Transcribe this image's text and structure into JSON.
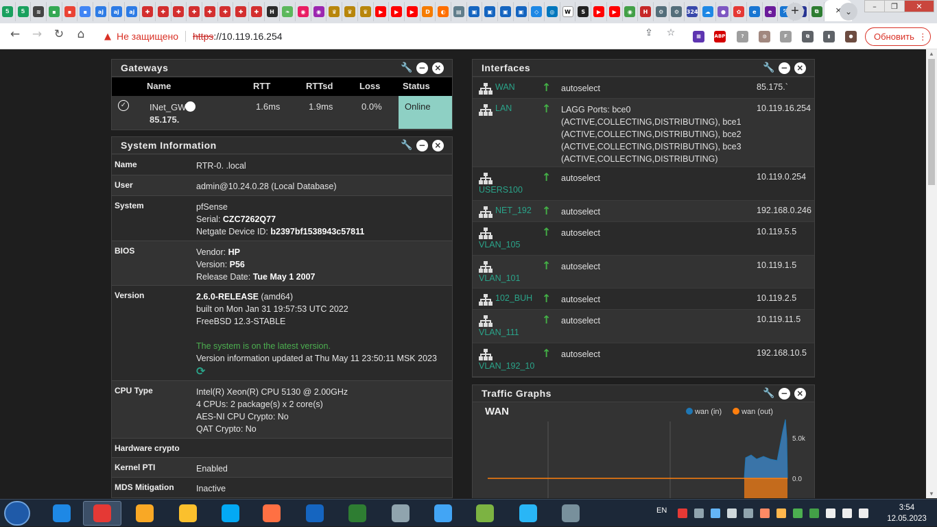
{
  "browser": {
    "tab_favicons": [
      {
        "name": "sheets",
        "color": "#1aa05e",
        "glyph": "Ꭶ"
      },
      {
        "name": "sheets",
        "color": "#1aa05e",
        "glyph": "Ꭶ"
      },
      {
        "name": "hub",
        "color": "#444444",
        "glyph": "≋"
      },
      {
        "name": "apps",
        "color": "#34a853",
        "glyph": "▪"
      },
      {
        "name": "apps",
        "color": "#ea4335",
        "glyph": "▪"
      },
      {
        "name": "apps",
        "color": "#4285f4",
        "glyph": "▪"
      },
      {
        "name": "aj",
        "color": "#2d7be5",
        "glyph": "aj"
      },
      {
        "name": "aj",
        "color": "#2d7be5",
        "glyph": "aj"
      },
      {
        "name": "aj",
        "color": "#2d7be5",
        "glyph": "aj"
      },
      {
        "name": "red-shield",
        "color": "#d32f2f",
        "glyph": "✚"
      },
      {
        "name": "red-shield",
        "color": "#d32f2f",
        "glyph": "✚"
      },
      {
        "name": "red-shield",
        "color": "#d32f2f",
        "glyph": "✚"
      },
      {
        "name": "red-shield",
        "color": "#d32f2f",
        "glyph": "✚"
      },
      {
        "name": "red-shield",
        "color": "#d32f2f",
        "glyph": "✚"
      },
      {
        "name": "red-shield",
        "color": "#d32f2f",
        "glyph": "✚"
      },
      {
        "name": "red-shield",
        "color": "#d32f2f",
        "glyph": "✚"
      },
      {
        "name": "red-shield",
        "color": "#d32f2f",
        "glyph": "✚"
      },
      {
        "name": "shield",
        "color": "#2b2b2b",
        "glyph": "H"
      },
      {
        "name": "leaf",
        "color": "#5cb85c",
        "glyph": "❧"
      },
      {
        "name": "color-wheel",
        "color": "#e91e63",
        "glyph": "◉"
      },
      {
        "name": "color-wheel",
        "color": "#9c27b0",
        "glyph": "◉"
      },
      {
        "name": "emblem",
        "color": "#b8860b",
        "glyph": "♛"
      },
      {
        "name": "emblem",
        "color": "#b8860b",
        "glyph": "♛"
      },
      {
        "name": "emblem",
        "color": "#b8860b",
        "glyph": "♛"
      },
      {
        "name": "youtube",
        "color": "#ff0000",
        "glyph": "▶"
      },
      {
        "name": "youtube",
        "color": "#ff0000",
        "glyph": "▶"
      },
      {
        "name": "youtube",
        "color": "#ff0000",
        "glyph": "▶"
      },
      {
        "name": "dns",
        "color": "#f57c00",
        "glyph": "D"
      },
      {
        "name": "orange",
        "color": "#ff6f00",
        "glyph": "◐"
      },
      {
        "name": "grid",
        "color": "#607d8b",
        "glyph": "▤"
      },
      {
        "name": "lock",
        "color": "#1565c0",
        "glyph": "▣"
      },
      {
        "name": "lock",
        "color": "#1565c0",
        "glyph": "▣"
      },
      {
        "name": "lock",
        "color": "#1565c0",
        "glyph": "▣"
      },
      {
        "name": "lock",
        "color": "#1565c0",
        "glyph": "▣"
      },
      {
        "name": "cube",
        "color": "#1e88e5",
        "glyph": "◇"
      },
      {
        "name": "globe",
        "color": "#0277bd",
        "glyph": "◎"
      },
      {
        "name": "wiki",
        "color": "#ffffff",
        "glyph": "W"
      },
      {
        "name": "ws",
        "color": "#222222",
        "glyph": "S"
      },
      {
        "name": "youtube",
        "color": "#ff0000",
        "glyph": "▶"
      },
      {
        "name": "youtube",
        "color": "#ff0000",
        "glyph": "▶"
      },
      {
        "name": "chat",
        "color": "#43a047",
        "glyph": "◉"
      },
      {
        "name": "h",
        "color": "#c62828",
        "glyph": "H"
      },
      {
        "name": "gear",
        "color": "#546e7a",
        "glyph": "⚙"
      },
      {
        "name": "gear",
        "color": "#546e7a",
        "glyph": "⚙"
      },
      {
        "name": "counter",
        "color": "#3949ab",
        "glyph": "324"
      },
      {
        "name": "cloud",
        "color": "#1e88e5",
        "glyph": "☁"
      },
      {
        "name": "bubble",
        "color": "#7e57c2",
        "glyph": "●"
      },
      {
        "name": "flower",
        "color": "#e53935",
        "glyph": "✿"
      },
      {
        "name": "edge",
        "color": "#1976d2",
        "glyph": "e"
      },
      {
        "name": "e-purple",
        "color": "#6a1b9a",
        "glyph": "e"
      },
      {
        "name": "arrows",
        "color": "#1976d2",
        "glyph": "⤧"
      },
      {
        "name": "pf",
        "color": "#283593",
        "glyph": "pf"
      },
      {
        "name": "puzzle",
        "color": "#2e7d32",
        "glyph": "⧉"
      }
    ],
    "active_tab_glyph": "×",
    "new_tab": "+",
    "tab_search": "⌄",
    "window_buttons": [
      "–",
      "❐",
      "✕"
    ],
    "nav": {
      "back": "←",
      "forward": "→",
      "reload": "↻",
      "home": "⌂"
    },
    "omnibox": {
      "warn_icon": "▲",
      "security_text": "Не защищено",
      "url_proto": "https",
      "url_rest": "://10.119.16.254"
    },
    "omnibox_icons": {
      "share": "⇪",
      "bookmark": "☆"
    },
    "extensions": [
      {
        "name": "colorful-ext",
        "color": "#5e35b1",
        "glyph": "▦"
      },
      {
        "name": "adblock",
        "color": "#d50000",
        "glyph": "ABP"
      },
      {
        "name": "hint",
        "color": "#9e9e9e",
        "glyph": "?"
      },
      {
        "name": "cookie",
        "color": "#a1887f",
        "glyph": "◍"
      },
      {
        "name": "f-ext",
        "color": "#9e9e9e",
        "glyph": "F"
      },
      {
        "name": "puzzle",
        "color": "#5f6368",
        "glyph": "⧉"
      },
      {
        "name": "sidepanel",
        "color": "#5f6368",
        "glyph": "▮"
      },
      {
        "name": "profile",
        "color": "#6d4c41",
        "glyph": "●"
      }
    ],
    "update_button": "Обновить",
    "update_menu": "⋮"
  },
  "gateways": {
    "title": "Gateways",
    "headers": {
      "name": "Name",
      "rtt": "RTT",
      "rttsd": "RTTsd",
      "loss": "Loss",
      "status": "Status"
    },
    "row": {
      "status_icon": "✓",
      "name": "INet_GW",
      "ip": "85.175.",
      "rtt": "1.6ms",
      "rttsd": "1.9ms",
      "loss": "0.0%",
      "status": "Online"
    }
  },
  "sysinfo": {
    "title": "System Information",
    "rows": [
      {
        "key": "Name",
        "lines": [
          "RTR-0.        .local"
        ]
      },
      {
        "key": "User",
        "lines": [
          "admin@10.24.0.28 (Local Database)"
        ]
      },
      {
        "key": "System",
        "lines": [
          "pfSense",
          "Serial: <b>CZC7262Q77</b>",
          "Netgate Device ID: <b>b2397bf1538943c57811</b>"
        ]
      },
      {
        "key": "BIOS",
        "lines": [
          "Vendor: <b>HP</b>",
          "Version: <b>P56</b>",
          "Release Date: <b>Tue May 1 2007</b>"
        ]
      },
      {
        "key": "Version",
        "lines": [
          "<b>2.6.0-RELEASE</b> (amd64)",
          "built on Mon Jan 31 19:57:53 UTC 2022",
          "FreeBSD 12.3-STABLE",
          "",
          "<span class='green'>The system is on the latest version.</span>",
          "Version information updated at Thu May 11 23:50:11 MSK 2023"
        ]
      },
      {
        "key": "CPU Type",
        "lines": [
          "Intel(R) Xeon(R) CPU 5130 @ 2.00GHz",
          "4 CPUs: 2 package(s) x 2 core(s)",
          "AES-NI CPU Crypto: No",
          "QAT Crypto: No"
        ]
      },
      {
        "key": "Hardware crypto",
        "lines": []
      },
      {
        "key": "Kernel PTI",
        "lines": [
          "Enabled"
        ]
      },
      {
        "key": "MDS Mitigation",
        "lines": [
          "Inactive"
        ]
      }
    ]
  },
  "interfaces": {
    "title": "Interfaces",
    "rows": [
      {
        "name": "WAN",
        "inline": true,
        "link": [
          "autoselect"
        ],
        "ip": "85.175.`"
      },
      {
        "name": "LAN",
        "inline": true,
        "link": [
          "LAGG Ports: bce0",
          "(ACTIVE,COLLECTING,DISTRIBUTING), bce1",
          "(ACTIVE,COLLECTING,DISTRIBUTING), bce2",
          "(ACTIVE,COLLECTING,DISTRIBUTING), bce3",
          "(ACTIVE,COLLECTING,DISTRIBUTING)"
        ],
        "ip": "10.119.16.254"
      },
      {
        "name": "USERS100",
        "inline": false,
        "link": [
          "autoselect"
        ],
        "ip": "10.119.0.254"
      },
      {
        "name": "NET_192",
        "inline": true,
        "link": [
          "autoselect"
        ],
        "ip": "192.168.0.246"
      },
      {
        "name": "VLAN_105",
        "inline": false,
        "link": [
          "autoselect"
        ],
        "ip": "10.119.5.5"
      },
      {
        "name": "VLAN_101",
        "inline": false,
        "link": [
          "autoselect"
        ],
        "ip": "10.119.1.5"
      },
      {
        "name": "102_BUH",
        "inline": true,
        "link": [
          "autoselect"
        ],
        "ip": "10.119.2.5"
      },
      {
        "name": "VLAN_111",
        "inline": false,
        "link": [
          "autoselect"
        ],
        "ip": "10.119.11.5"
      },
      {
        "name": "VLAN_192_10",
        "inline": false,
        "link": [
          "autoselect"
        ],
        "ip": "192.168.10.5"
      }
    ],
    "up_arrow": "↑"
  },
  "traffic": {
    "title": "Traffic Graphs",
    "chart_data": {
      "type": "area",
      "title": "WAN",
      "series": [
        {
          "name": "wan (in)",
          "color": "#1f77b4"
        },
        {
          "name": "wan (out)",
          "color": "#ff7f0e"
        }
      ],
      "y_ticks": [
        "5.0k",
        "0.0"
      ]
    }
  },
  "panel_controls": {
    "wrench": "🔧",
    "minus": "−",
    "close": "×"
  },
  "taskbar": {
    "apps": [
      {
        "name": "ie",
        "color": "#1e88e5"
      },
      {
        "name": "chrome",
        "color": "#e53935",
        "active": true
      },
      {
        "name": "outlook",
        "color": "#f9a825"
      },
      {
        "name": "explorer",
        "color": "#fbc02d"
      },
      {
        "name": "skype",
        "color": "#03a9f4"
      },
      {
        "name": "media",
        "color": "#ff7043"
      },
      {
        "name": "mail",
        "color": "#1565c0"
      },
      {
        "name": "excel",
        "color": "#2e7d32"
      },
      {
        "name": "search",
        "color": "#90a4ae"
      },
      {
        "name": "control-panel",
        "color": "#42a5f5"
      },
      {
        "name": "vmware",
        "color": "#7cb342"
      },
      {
        "name": "telegram",
        "color": "#29b6f6"
      },
      {
        "name": "network",
        "color": "#78909c"
      }
    ],
    "lang": "EN",
    "time": "3:54",
    "date": "12.05.2023"
  }
}
